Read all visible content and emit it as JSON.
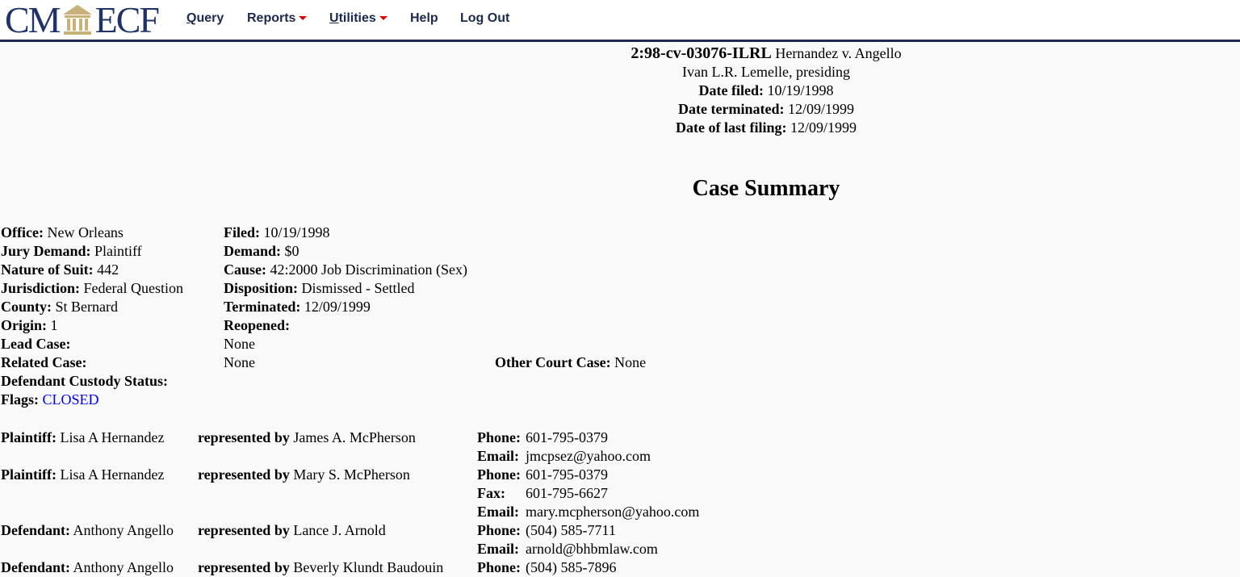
{
  "nav": {
    "logo": "CM/ECF",
    "items": [
      {
        "label": "Query",
        "u": "Q",
        "rest": "uery"
      },
      {
        "label": "Reports"
      },
      {
        "label": "Utilities",
        "u": "U",
        "rest": "tilities"
      },
      {
        "label": "Help"
      },
      {
        "label": "Log Out"
      }
    ]
  },
  "header": {
    "case_number": "2:98-cv-03076-ILRL",
    "case_title": "Hernandez v. Angello",
    "presiding": "Ivan L.R. Lemelle, presiding",
    "date_filed_label": "Date filed:",
    "date_filed": "10/19/1998",
    "date_terminated_label": "Date terminated:",
    "date_terminated": "12/09/1999",
    "last_filing_label": "Date of last filing:",
    "last_filing": "12/09/1999"
  },
  "summary_title": "Case Summary",
  "info": [
    {
      "l": "Office:",
      "v": "New Orleans",
      "l2": "Filed:",
      "v2": "10/19/1998"
    },
    {
      "l": "Jury Demand:",
      "v": "Plaintiff",
      "l2": "Demand:",
      "v2": "$0"
    },
    {
      "l": "Nature of Suit:",
      "v": "442",
      "l2": "Cause:",
      "v2": "42:2000 Job Discrimination (Sex)"
    },
    {
      "l": "Jurisdiction:",
      "v": "Federal Question",
      "l2": "Disposition:",
      "v2": "Dismissed - Settled"
    },
    {
      "l": "County:",
      "v": "St Bernard",
      "l2": "Terminated:",
      "v2": "12/09/1999"
    },
    {
      "l": "Origin:",
      "v": "1",
      "l2": "Reopened:",
      "v2": ""
    },
    {
      "l": "Lead Case:",
      "v": "",
      "l2": "",
      "v2": "None"
    },
    {
      "l": "Related Case:",
      "v": "",
      "l2": "",
      "v2": "None",
      "l3": "Other Court Case:",
      "v3": "None"
    },
    {
      "l": "Defendant Custody Status:",
      "v": "",
      "l2": "",
      "v2": ""
    },
    {
      "l": "Flags:",
      "v": "CLOSED",
      "l2": "",
      "v2": ""
    }
  ],
  "represented_by": "represented by",
  "parties": [
    {
      "role": "Plaintiff:",
      "name": "Lisa A Hernandez",
      "attorney": "James A. McPherson",
      "contacts": [
        {
          "k": "Phone:",
          "v": "601-795-0379"
        },
        {
          "k": "Email:",
          "v": "jmcpsez@yahoo.com"
        }
      ]
    },
    {
      "role": "Plaintiff:",
      "name": "Lisa A Hernandez",
      "attorney": "Mary S. McPherson",
      "contacts": [
        {
          "k": "Phone:",
          "v": "601-795-0379"
        },
        {
          "k": "Fax:",
          "v": "601-795-6627"
        },
        {
          "k": "Email:",
          "v": "mary.mcpherson@yahoo.com"
        }
      ]
    },
    {
      "role": "Defendant:",
      "name": "Anthony Angello",
      "attorney": "Lance J. Arnold",
      "contacts": [
        {
          "k": "Phone:",
          "v": "(504) 585-7711"
        },
        {
          "k": "Email:",
          "v": "arnold@bhbmlaw.com"
        }
      ]
    },
    {
      "role": "Defendant:",
      "name": "Anthony Angello",
      "attorney": "Beverly Klundt Baudouin",
      "contacts": [
        {
          "k": "Phone:",
          "v": "(504) 585-7896"
        }
      ]
    }
  ]
}
